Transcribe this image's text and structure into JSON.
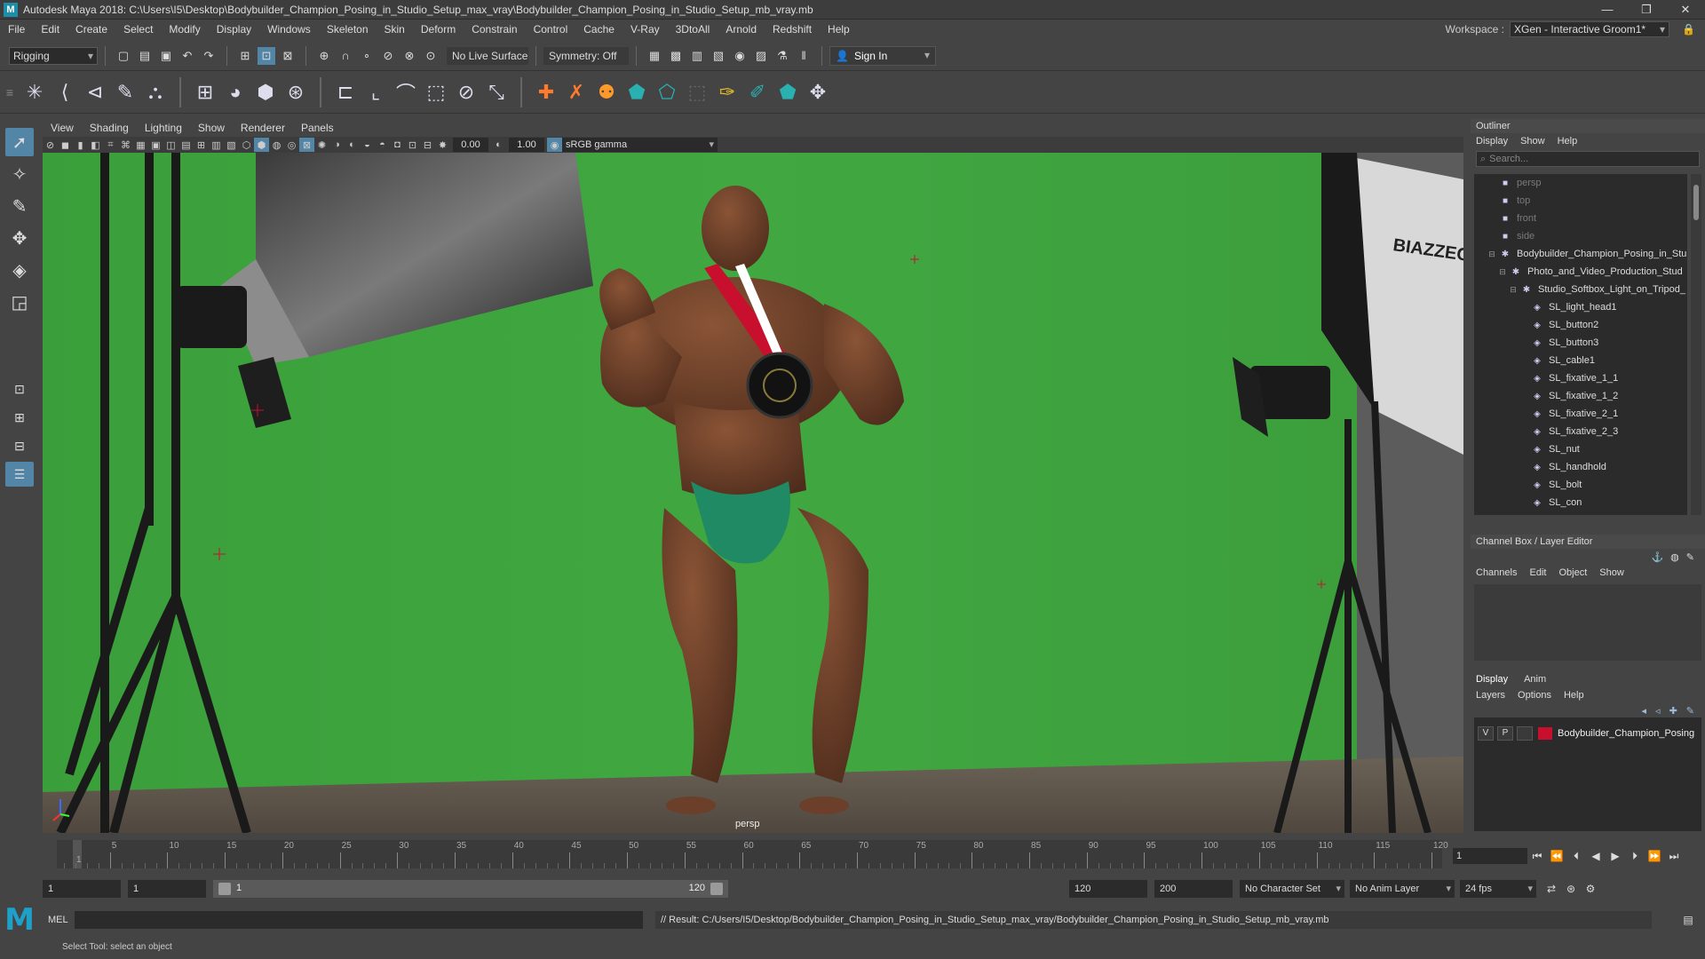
{
  "window": {
    "title": "Autodesk Maya 2018: C:\\Users\\I5\\Desktop\\Bodybuilder_Champion_Posing_in_Studio_Setup_max_vray\\Bodybuilder_Champion_Posing_in_Studio_Setup_mb_vray.mb",
    "logo_letter": "M",
    "minimize": "—",
    "restore": "❐",
    "close": "✕"
  },
  "menubar": {
    "items": [
      "File",
      "Edit",
      "Create",
      "Select",
      "Modify",
      "Display",
      "Windows",
      "Skeleton",
      "Skin",
      "Deform",
      "Constrain",
      "Control",
      "Cache",
      "V-Ray",
      "3DtoAll",
      "Arnold",
      "Redshift",
      "Help"
    ],
    "workspace_label": "Workspace :",
    "workspace_value": "XGen - Interactive Groom1*"
  },
  "statusline": {
    "mode": "Rigging",
    "live_surface": "No Live Surface",
    "symmetry": "Symmetry: Off",
    "sign_in": "Sign In"
  },
  "viewport": {
    "menus": [
      "View",
      "Shading",
      "Lighting",
      "Show",
      "Renderer",
      "Panels"
    ],
    "exposure": "0.00",
    "gamma_value": "1.00",
    "color_space": "sRGB gamma",
    "camera_label": "persp"
  },
  "outliner": {
    "title": "Outliner",
    "menus": [
      "Display",
      "Show",
      "Help"
    ],
    "search_placeholder": "Search...",
    "items": [
      {
        "label": "persp",
        "dim": true,
        "indent": 0,
        "icon": "camera"
      },
      {
        "label": "top",
        "dim": true,
        "indent": 0,
        "icon": "camera"
      },
      {
        "label": "front",
        "dim": true,
        "indent": 0,
        "icon": "camera"
      },
      {
        "label": "side",
        "dim": true,
        "indent": 0,
        "icon": "camera"
      },
      {
        "label": "Bodybuilder_Champion_Posing_in_Stu",
        "dim": false,
        "indent": 0,
        "icon": "group",
        "exp": "⊟"
      },
      {
        "label": "Photo_and_Video_Production_Stud",
        "dim": false,
        "indent": 1,
        "icon": "group",
        "exp": "⊟"
      },
      {
        "label": "Studio_Softbox_Light_on_Tripod_",
        "dim": false,
        "indent": 2,
        "icon": "group",
        "exp": "⊟"
      },
      {
        "label": "SL_light_head1",
        "dim": false,
        "indent": 3,
        "icon": "mesh"
      },
      {
        "label": "SL_button2",
        "dim": false,
        "indent": 3,
        "icon": "mesh"
      },
      {
        "label": "SL_button3",
        "dim": false,
        "indent": 3,
        "icon": "mesh"
      },
      {
        "label": "SL_cable1",
        "dim": false,
        "indent": 3,
        "icon": "mesh"
      },
      {
        "label": "SL_fixative_1_1",
        "dim": false,
        "indent": 3,
        "icon": "mesh"
      },
      {
        "label": "SL_fixative_1_2",
        "dim": false,
        "indent": 3,
        "icon": "mesh"
      },
      {
        "label": "SL_fixative_2_1",
        "dim": false,
        "indent": 3,
        "icon": "mesh"
      },
      {
        "label": "SL_fixative_2_3",
        "dim": false,
        "indent": 3,
        "icon": "mesh"
      },
      {
        "label": "SL_nut",
        "dim": false,
        "indent": 3,
        "icon": "mesh"
      },
      {
        "label": "SL_handhold",
        "dim": false,
        "indent": 3,
        "icon": "mesh"
      },
      {
        "label": "SL_bolt",
        "dim": false,
        "indent": 3,
        "icon": "mesh"
      },
      {
        "label": "SL_con",
        "dim": false,
        "indent": 3,
        "icon": "mesh"
      }
    ]
  },
  "channelbox": {
    "title": "Channel Box / Layer Editor",
    "menus": [
      "Channels",
      "Edit",
      "Object",
      "Show"
    ]
  },
  "layereditor": {
    "tabs": [
      "Display",
      "Anim"
    ],
    "menus": [
      "Layers",
      "Options",
      "Help"
    ],
    "layer": {
      "v": "V",
      "p": "P",
      "name": "Bodybuilder_Champion_Posing",
      "color": "#c8102e"
    }
  },
  "timeslider": {
    "labels": [
      "5",
      "10",
      "15",
      "20",
      "25",
      "30",
      "35",
      "40",
      "45",
      "50",
      "55",
      "60",
      "65",
      "70",
      "75",
      "80",
      "85",
      "90",
      "95",
      "100",
      "105",
      "110",
      "115",
      "120"
    ],
    "start_label": "1",
    "current_frame": "1"
  },
  "rangebar": {
    "start": "1",
    "playback_start": "1",
    "range_left": "1",
    "range_right": "120",
    "playback_end": "120",
    "end": "200",
    "character_set": "No Character Set",
    "anim_layer": "No Anim Layer",
    "fps": "24 fps"
  },
  "cmdline": {
    "label": "MEL",
    "result": "// Result: C:/Users/I5/Desktop/Bodybuilder_Champion_Posing_in_Studio_Setup_max_vray/Bodybuilder_Champion_Posing_in_Studio_Setup_mb_vray.mb"
  },
  "helpline": {
    "text": "Select Tool: select an object"
  },
  "colors": {
    "greenscreen": "#3aa33a",
    "skin": "#6b3f2a",
    "trunks": "#1f8a64",
    "accent": "#5285a6",
    "layer_color": "#c8102e"
  }
}
